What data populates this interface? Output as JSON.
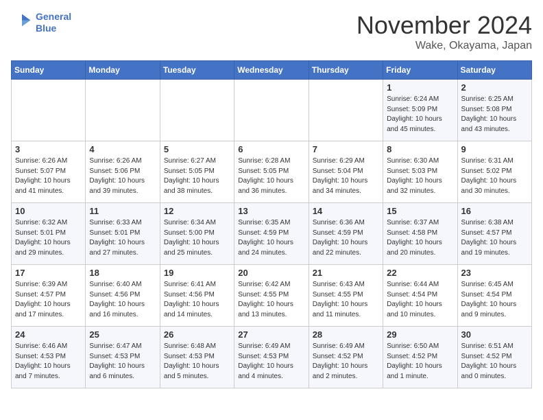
{
  "header": {
    "logo_line1": "General",
    "logo_line2": "Blue",
    "month": "November 2024",
    "location": "Wake, Okayama, Japan"
  },
  "weekdays": [
    "Sunday",
    "Monday",
    "Tuesday",
    "Wednesday",
    "Thursday",
    "Friday",
    "Saturday"
  ],
  "weeks": [
    [
      {
        "day": "",
        "info": ""
      },
      {
        "day": "",
        "info": ""
      },
      {
        "day": "",
        "info": ""
      },
      {
        "day": "",
        "info": ""
      },
      {
        "day": "",
        "info": ""
      },
      {
        "day": "1",
        "info": "Sunrise: 6:24 AM\nSunset: 5:09 PM\nDaylight: 10 hours\nand 45 minutes."
      },
      {
        "day": "2",
        "info": "Sunrise: 6:25 AM\nSunset: 5:08 PM\nDaylight: 10 hours\nand 43 minutes."
      }
    ],
    [
      {
        "day": "3",
        "info": "Sunrise: 6:26 AM\nSunset: 5:07 PM\nDaylight: 10 hours\nand 41 minutes."
      },
      {
        "day": "4",
        "info": "Sunrise: 6:26 AM\nSunset: 5:06 PM\nDaylight: 10 hours\nand 39 minutes."
      },
      {
        "day": "5",
        "info": "Sunrise: 6:27 AM\nSunset: 5:05 PM\nDaylight: 10 hours\nand 38 minutes."
      },
      {
        "day": "6",
        "info": "Sunrise: 6:28 AM\nSunset: 5:05 PM\nDaylight: 10 hours\nand 36 minutes."
      },
      {
        "day": "7",
        "info": "Sunrise: 6:29 AM\nSunset: 5:04 PM\nDaylight: 10 hours\nand 34 minutes."
      },
      {
        "day": "8",
        "info": "Sunrise: 6:30 AM\nSunset: 5:03 PM\nDaylight: 10 hours\nand 32 minutes."
      },
      {
        "day": "9",
        "info": "Sunrise: 6:31 AM\nSunset: 5:02 PM\nDaylight: 10 hours\nand 30 minutes."
      }
    ],
    [
      {
        "day": "10",
        "info": "Sunrise: 6:32 AM\nSunset: 5:01 PM\nDaylight: 10 hours\nand 29 minutes."
      },
      {
        "day": "11",
        "info": "Sunrise: 6:33 AM\nSunset: 5:01 PM\nDaylight: 10 hours\nand 27 minutes."
      },
      {
        "day": "12",
        "info": "Sunrise: 6:34 AM\nSunset: 5:00 PM\nDaylight: 10 hours\nand 25 minutes."
      },
      {
        "day": "13",
        "info": "Sunrise: 6:35 AM\nSunset: 4:59 PM\nDaylight: 10 hours\nand 24 minutes."
      },
      {
        "day": "14",
        "info": "Sunrise: 6:36 AM\nSunset: 4:59 PM\nDaylight: 10 hours\nand 22 minutes."
      },
      {
        "day": "15",
        "info": "Sunrise: 6:37 AM\nSunset: 4:58 PM\nDaylight: 10 hours\nand 20 minutes."
      },
      {
        "day": "16",
        "info": "Sunrise: 6:38 AM\nSunset: 4:57 PM\nDaylight: 10 hours\nand 19 minutes."
      }
    ],
    [
      {
        "day": "17",
        "info": "Sunrise: 6:39 AM\nSunset: 4:57 PM\nDaylight: 10 hours\nand 17 minutes."
      },
      {
        "day": "18",
        "info": "Sunrise: 6:40 AM\nSunset: 4:56 PM\nDaylight: 10 hours\nand 16 minutes."
      },
      {
        "day": "19",
        "info": "Sunrise: 6:41 AM\nSunset: 4:56 PM\nDaylight: 10 hours\nand 14 minutes."
      },
      {
        "day": "20",
        "info": "Sunrise: 6:42 AM\nSunset: 4:55 PM\nDaylight: 10 hours\nand 13 minutes."
      },
      {
        "day": "21",
        "info": "Sunrise: 6:43 AM\nSunset: 4:55 PM\nDaylight: 10 hours\nand 11 minutes."
      },
      {
        "day": "22",
        "info": "Sunrise: 6:44 AM\nSunset: 4:54 PM\nDaylight: 10 hours\nand 10 minutes."
      },
      {
        "day": "23",
        "info": "Sunrise: 6:45 AM\nSunset: 4:54 PM\nDaylight: 10 hours\nand 9 minutes."
      }
    ],
    [
      {
        "day": "24",
        "info": "Sunrise: 6:46 AM\nSunset: 4:53 PM\nDaylight: 10 hours\nand 7 minutes."
      },
      {
        "day": "25",
        "info": "Sunrise: 6:47 AM\nSunset: 4:53 PM\nDaylight: 10 hours\nand 6 minutes."
      },
      {
        "day": "26",
        "info": "Sunrise: 6:48 AM\nSunset: 4:53 PM\nDaylight: 10 hours\nand 5 minutes."
      },
      {
        "day": "27",
        "info": "Sunrise: 6:49 AM\nSunset: 4:53 PM\nDaylight: 10 hours\nand 4 minutes."
      },
      {
        "day": "28",
        "info": "Sunrise: 6:49 AM\nSunset: 4:52 PM\nDaylight: 10 hours\nand 2 minutes."
      },
      {
        "day": "29",
        "info": "Sunrise: 6:50 AM\nSunset: 4:52 PM\nDaylight: 10 hours\nand 1 minute."
      },
      {
        "day": "30",
        "info": "Sunrise: 6:51 AM\nSunset: 4:52 PM\nDaylight: 10 hours\nand 0 minutes."
      }
    ]
  ]
}
